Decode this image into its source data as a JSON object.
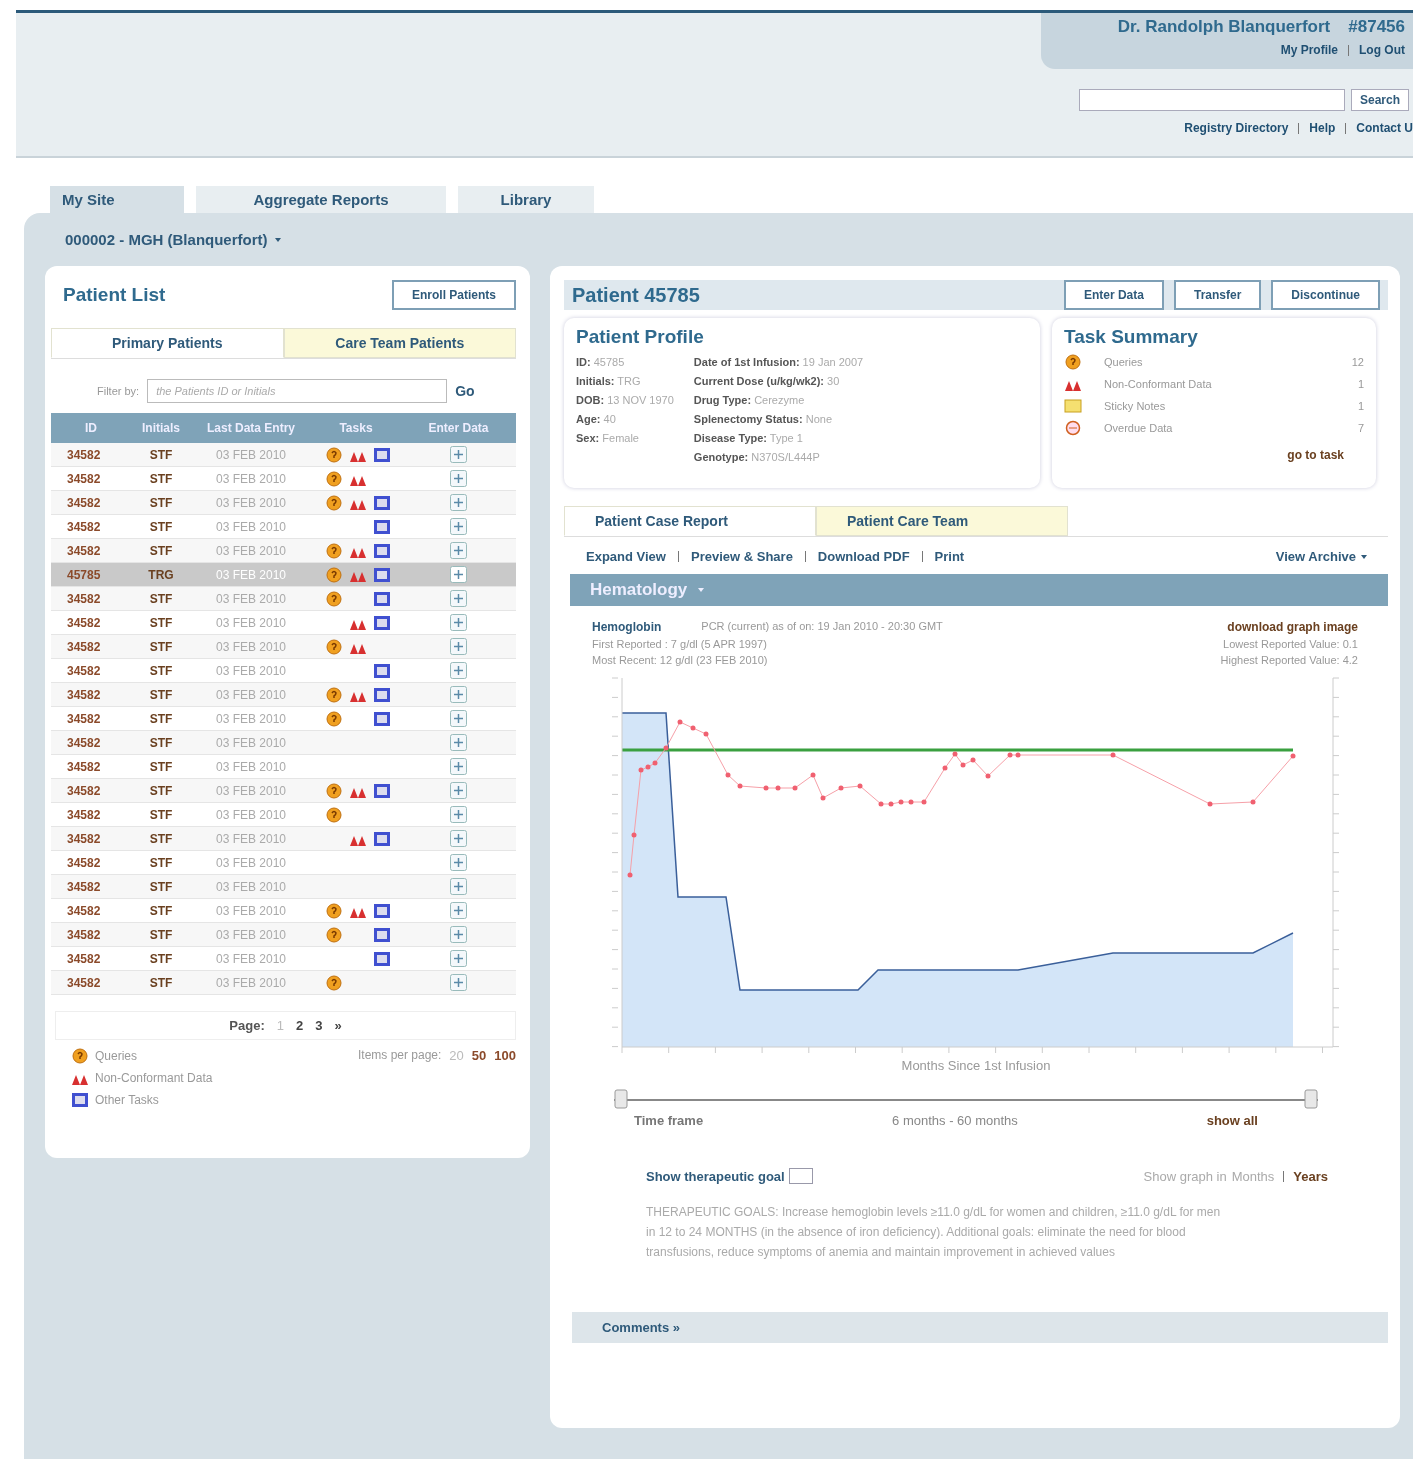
{
  "header": {
    "user": "Dr. Randolph Blanquerfort",
    "user_id": "#87456",
    "user_links": [
      "My Profile",
      "Log Out"
    ],
    "search_button": "Search",
    "links": [
      "Registry Directory",
      "Help",
      "Contact U"
    ]
  },
  "tabs": [
    {
      "label": "My Site",
      "selected": true
    },
    {
      "label": "Aggregate Reports",
      "selected": false
    },
    {
      "label": "Library",
      "selected": false
    }
  ],
  "site": "000002 - MGH (Blanquerfort)",
  "patient_list": {
    "title": "Patient List",
    "enroll_button": "Enroll Patients",
    "tabs": [
      {
        "label": "Primary Patients",
        "selected": true
      },
      {
        "label": "Care Team Patients",
        "selected": false
      }
    ],
    "filter_label": "Filter by:",
    "filter_placeholder": "the Patients ID or Initials",
    "go": "Go",
    "columns": [
      "ID",
      "Initials",
      "Last Data Entry",
      "Tasks",
      "Enter Data"
    ],
    "rows": [
      {
        "id": "34582",
        "initials": "STF",
        "date": "03 FEB 2010",
        "query": true,
        "nonconformant": true,
        "other": true,
        "selected": false
      },
      {
        "id": "34582",
        "initials": "STF",
        "date": "03 FEB 2010",
        "query": true,
        "nonconformant": true,
        "other": false,
        "selected": false
      },
      {
        "id": "34582",
        "initials": "STF",
        "date": "03 FEB 2010",
        "query": true,
        "nonconformant": true,
        "other": true,
        "selected": false
      },
      {
        "id": "34582",
        "initials": "STF",
        "date": "03 FEB 2010",
        "query": false,
        "nonconformant": false,
        "other": true,
        "selected": false
      },
      {
        "id": "34582",
        "initials": "STF",
        "date": "03 FEB 2010",
        "query": true,
        "nonconformant": true,
        "other": true,
        "selected": false
      },
      {
        "id": "45785",
        "initials": "TRG",
        "date": "03 FEB 2010",
        "query": true,
        "nonconformant": true,
        "other": true,
        "selected": true
      },
      {
        "id": "34582",
        "initials": "STF",
        "date": "03 FEB 2010",
        "query": true,
        "nonconformant": false,
        "other": true,
        "selected": false
      },
      {
        "id": "34582",
        "initials": "STF",
        "date": "03 FEB 2010",
        "query": false,
        "nonconformant": true,
        "other": true,
        "selected": false
      },
      {
        "id": "34582",
        "initials": "STF",
        "date": "03 FEB 2010",
        "query": true,
        "nonconformant": true,
        "other": false,
        "selected": false
      },
      {
        "id": "34582",
        "initials": "STF",
        "date": "03 FEB 2010",
        "query": false,
        "nonconformant": false,
        "other": true,
        "selected": false
      },
      {
        "id": "34582",
        "initials": "STF",
        "date": "03 FEB 2010",
        "query": true,
        "nonconformant": true,
        "other": true,
        "selected": false
      },
      {
        "id": "34582",
        "initials": "STF",
        "date": "03 FEB 2010",
        "query": true,
        "nonconformant": false,
        "other": true,
        "selected": false
      },
      {
        "id": "34582",
        "initials": "STF",
        "date": "03 FEB 2010",
        "query": false,
        "nonconformant": false,
        "other": false,
        "selected": false
      },
      {
        "id": "34582",
        "initials": "STF",
        "date": "03 FEB 2010",
        "query": false,
        "nonconformant": false,
        "other": false,
        "selected": false
      },
      {
        "id": "34582",
        "initials": "STF",
        "date": "03 FEB 2010",
        "query": true,
        "nonconformant": true,
        "other": true,
        "selected": false
      },
      {
        "id": "34582",
        "initials": "STF",
        "date": "03 FEB 2010",
        "query": true,
        "nonconformant": false,
        "other": false,
        "selected": false
      },
      {
        "id": "34582",
        "initials": "STF",
        "date": "03 FEB 2010",
        "query": false,
        "nonconformant": true,
        "other": true,
        "selected": false
      },
      {
        "id": "34582",
        "initials": "STF",
        "date": "03 FEB 2010",
        "query": false,
        "nonconformant": false,
        "other": false,
        "selected": false
      },
      {
        "id": "34582",
        "initials": "STF",
        "date": "03 FEB 2010",
        "query": false,
        "nonconformant": false,
        "other": false,
        "selected": false
      },
      {
        "id": "34582",
        "initials": "STF",
        "date": "03 FEB 2010",
        "query": true,
        "nonconformant": true,
        "other": true,
        "selected": false
      },
      {
        "id": "34582",
        "initials": "STF",
        "date": "03 FEB 2010",
        "query": true,
        "nonconformant": false,
        "other": true,
        "selected": false
      },
      {
        "id": "34582",
        "initials": "STF",
        "date": "03 FEB 2010",
        "query": false,
        "nonconformant": false,
        "other": true,
        "selected": false
      },
      {
        "id": "34582",
        "initials": "STF",
        "date": "03 FEB 2010",
        "query": true,
        "nonconformant": false,
        "other": false,
        "selected": false
      }
    ],
    "page_label": "Page:",
    "pages": [
      {
        "label": "1",
        "selected": true
      },
      {
        "label": "2",
        "selected": false
      },
      {
        "label": "3",
        "selected": false
      }
    ],
    "next": "»",
    "legend": [
      {
        "kind": "query",
        "label": "Queries"
      },
      {
        "kind": "nonconformant",
        "label": "Non-Conformant Data"
      },
      {
        "kind": "other",
        "label": "Other Tasks"
      }
    ],
    "items_per_page_label": "Items per page:",
    "items_per_page": [
      {
        "label": "20",
        "selected": true
      },
      {
        "label": "50",
        "selected": false
      },
      {
        "label": "100",
        "selected": false
      }
    ]
  },
  "patient": {
    "title": "Patient 45785",
    "buttons": [
      "Enter Data",
      "Transfer",
      "Discontinue"
    ],
    "profile_title": "Patient Profile",
    "profile_left": [
      "**ID:** 45785",
      "**Initials:** TRG",
      "**DOB:** 13 NOV 1970",
      "**Age:** 40",
      "**Sex:** Female"
    ],
    "profile_right": [
      "**Date of 1st Infusion:** 19 Jan 2007",
      "**Current Dose (u/kg/wk2):** 30",
      "**Drug Type:** Cerezyme",
      "**Splenectomy Status:** None",
      "**Disease Type:** Type 1",
      "**Genotype:** N370S/L444P"
    ],
    "task_summary": {
      "title": "Task Summary",
      "items": [
        {
          "kind": "query",
          "label": "Queries",
          "count": "12"
        },
        {
          "kind": "nonconformant",
          "label": "Non-Conformant Data",
          "count": "1"
        },
        {
          "kind": "note",
          "label": "Sticky Notes",
          "count": "1"
        },
        {
          "kind": "overdue",
          "label": "Overdue Data",
          "count": "7"
        }
      ],
      "link": "go to task"
    },
    "tabs": [
      {
        "label": "Patient Case Report",
        "selected": true
      },
      {
        "label": "Patient Care Team",
        "selected": false
      }
    ],
    "actions": [
      "Expand View",
      "Preview & Share",
      "Download PDF",
      "Print"
    ],
    "archive": "View Archive",
    "section": "Hematology",
    "measure": "Hemoglobin",
    "as_of": "PCR (current) as of on: 19 Jan 2010 - 20:30 GMT",
    "first": "First Reported : 7 g/dl (5 APR 1997)",
    "recent": "Most Recent: 12 g/dl (23 FEB 2010)",
    "download": "download graph image",
    "lowest": "Lowest Reported Value: 0.1",
    "highest": "Highest Reported Value: 4.2",
    "x_title": "Months Since 1st Infusion",
    "time_frame": "Time frame",
    "range": "6 months - 60 months",
    "show_all": "show all",
    "goal_label": "Show therapeutic goal",
    "goal_checked": false,
    "graph_in": "Show graph in",
    "units": [
      {
        "label": "Months",
        "selected": false
      },
      {
        "label": "Years",
        "selected": true
      }
    ],
    "goals_text": "THERAPEUTIC GOALS: Increase hemoglobin levels ≥11.0 g/dL for women and children, ≥11.0 g/dL for men in 12 to 24 MONTHS (in the absence of iron deficiency). Additional goals: eliminate the need for blood transfusions, reduce symptoms of anemia and maintain improvement in achieved values",
    "comments": "Comments »"
  }
}
